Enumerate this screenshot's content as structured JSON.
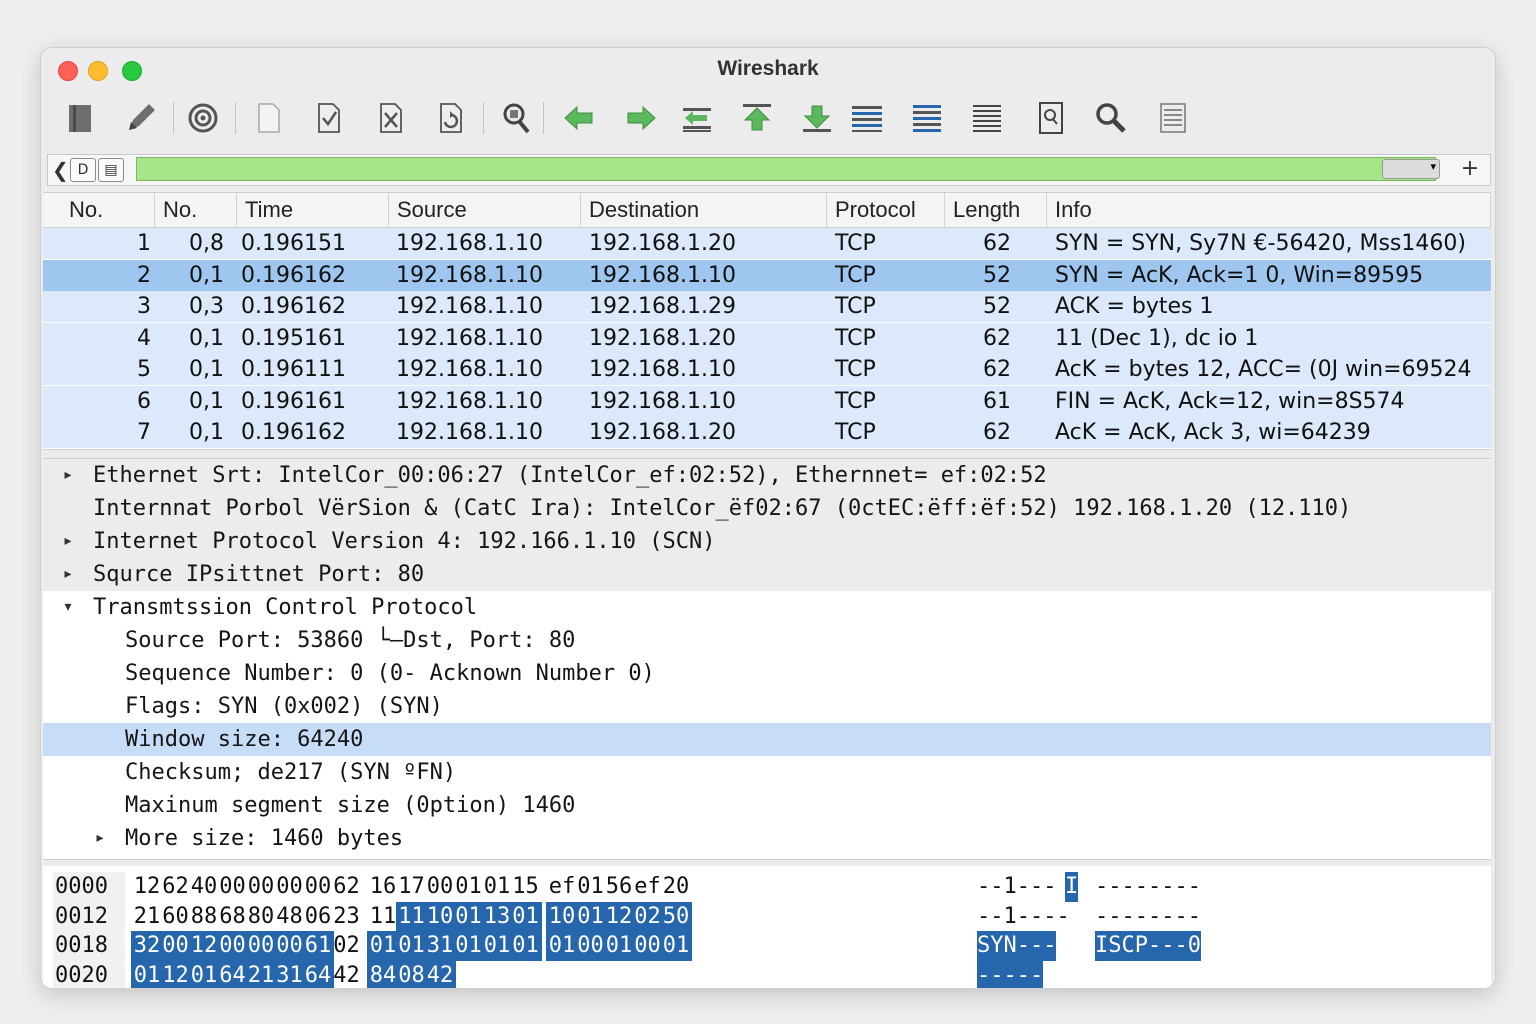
{
  "window": {
    "title": "Wireshark"
  },
  "colors": {
    "filter_bg": "#a8e58a",
    "row_bg": "#dbe9fb",
    "row_selected": "#9ec6ee",
    "hex_highlight": "#2566ad",
    "arrow_green": "#5cb85c"
  },
  "toolbar": {
    "icons": [
      "open-file-icon",
      "edit-icon",
      "capture-target-icon",
      "blank-file-icon",
      "save-icon",
      "close-file-icon",
      "reload-icon",
      "find-packet-icon",
      "go-back-icon",
      "go-forward-icon",
      "go-to-packet-icon",
      "first-packet-icon",
      "last-packet-icon",
      "autoscroll-icon",
      "colorize-icon",
      "resize-columns-icon",
      "zoom-in-icon",
      "zoom-search-icon",
      "column-prefs-icon"
    ]
  },
  "filter": {
    "value": "",
    "placeholder": "",
    "dropdown": "▾",
    "plus": "+",
    "left_arrow": "❮",
    "bookmark": "D",
    "bar_icon": "▤"
  },
  "packet_list": {
    "columns": [
      "No.",
      "No.",
      "Time",
      "Source",
      "Destination",
      "Protocol",
      "Length",
      "Info"
    ],
    "rows": [
      {
        "no": "1",
        "no2": "0,8",
        "time": "0.196151",
        "src": "192.168.1.10",
        "dst": "192.168.1.20",
        "proto": "TCP",
        "len": "62",
        "info": "SYN = SYN, Sy7N €-56420, Mss1460)"
      },
      {
        "no": "2",
        "no2": "0,1",
        "time": "0.196162",
        "src": "192.168.1.10",
        "dst": "192.168.1.10",
        "proto": "TCP",
        "len": "52",
        "info": "SYN = AcK, Ack=1 0, Win=89595"
      },
      {
        "no": "3",
        "no2": "0,3",
        "time": "0.196162",
        "src": "192.168.1.10",
        "dst": "192.168.1.29",
        "proto": "TCP",
        "len": "52",
        "info": "ACK = bytes 1"
      },
      {
        "no": "4",
        "no2": "0,1",
        "time": "0.195161",
        "src": "192.168.1.10",
        "dst": "192.168.1.20",
        "proto": "TCP",
        "len": "62",
        "info": "11 (Dec 1), dc io 1"
      },
      {
        "no": "5",
        "no2": "0,1",
        "time": "0.196111",
        "src": "192.168.1.10",
        "dst": "192.168.1.10",
        "proto": "TCP",
        "len": "62",
        "info": "AcK = bytes 12, ACC= (0J win=69524"
      },
      {
        "no": "6",
        "no2": "0,1",
        "time": "0.196161",
        "src": "192.168.1.10",
        "dst": "192.168.1.10",
        "proto": "TCP",
        "len": "61",
        "info": "FIN = AcK, Ack=12, win=8S574"
      },
      {
        "no": "7",
        "no2": "0,1",
        "time": "0.196162",
        "src": "192.168.1.10",
        "dst": "192.168.1.20",
        "proto": "TCP",
        "len": "62",
        "info": "AcK = AcK, Ack 3, wi=64239"
      }
    ]
  },
  "details": {
    "rows": [
      {
        "text": "Ethernet Srt: IntelCor_00:06:27 (IntelCor_ef:02:52), Ethernnet= ef:02:52",
        "arrow": "▸",
        "indent": 0,
        "style": "gray"
      },
      {
        "text": "Internnat Porbol VërSion & (CatC Ira): IntelCor_ëf02:67 (0ctEC:ëff:ëf:52) 192.168.1.20 (12.110)",
        "arrow": "",
        "indent": 0,
        "style": "gray"
      },
      {
        "text": "Internet Protocol Version 4: 192.166.1.10 (SCN)",
        "arrow": "▸",
        "indent": 0,
        "style": "gray"
      },
      {
        "text": "Squrce IPsittnet Port: 80",
        "arrow": "▸",
        "indent": 0,
        "style": "gray"
      },
      {
        "text": "Transmtssion Control Protocol",
        "arrow": "▾",
        "indent": 0,
        "style": ""
      },
      {
        "text": "Source Port: 53860 └—Dst, Port: 80",
        "arrow": "",
        "indent": 1,
        "style": ""
      },
      {
        "text": "Sequence Number: 0 (0- Acknown Number 0)",
        "arrow": "",
        "indent": 1,
        "style": ""
      },
      {
        "text": "Flags: SYN (0x002) (SYN)",
        "arrow": "",
        "indent": 1,
        "style": ""
      },
      {
        "text": "Window size: 64240",
        "arrow": "",
        "indent": 1,
        "style": "sel"
      },
      {
        "text": "Checksum; de217 (SYN ºFN)",
        "arrow": "",
        "indent": 1,
        "style": ""
      },
      {
        "text": "Maxinum segment size (0ption) 1460",
        "arrow": "",
        "indent": 1,
        "style": ""
      },
      {
        "text": "More size: 1460 bytes",
        "arrow": "▸",
        "indent": 1,
        "style": ""
      }
    ]
  },
  "hex": {
    "rows": [
      {
        "offset": "0000",
        "bytes": [
          "12",
          "62",
          "40",
          "00",
          "00",
          "00",
          "00",
          "62",
          "16",
          "17",
          "00",
          "01",
          "01",
          "15",
          "ef",
          "01",
          "56",
          "ef",
          "20"
        ],
        "hl_from": 99,
        "ascii": [
          "--1---",
          "I",
          "--------"
        ],
        "ascii_hl": [
          false,
          true,
          false
        ]
      },
      {
        "offset": "0012",
        "bytes": [
          "21",
          "60",
          "88",
          "68",
          "80",
          "48",
          "06",
          "23",
          "11",
          "11",
          "10",
          "01",
          "13",
          "01",
          "10",
          "01",
          "12",
          "02",
          "50"
        ],
        "hl_from": 9,
        "ascii": [
          "--1----",
          "",
          "--------"
        ],
        "ascii_hl": [
          false,
          false,
          false
        ]
      },
      {
        "offset": "0018",
        "bytes": [
          "32",
          "00",
          "12",
          "00",
          "00",
          "00",
          "61",
          "02",
          "01",
          "01",
          "31",
          "01",
          "01",
          "01",
          "01",
          "00",
          "01",
          "00",
          "01"
        ],
        "hl_from": 0,
        "hl_skip": 7,
        "ascii": [
          "SYN---",
          "",
          "ISCP---0"
        ],
        "ascii_hl": [
          true,
          false,
          true
        ]
      },
      {
        "offset": "0020",
        "bytes": [
          "01",
          "12",
          "01",
          "64",
          "21",
          "31",
          "64",
          "42",
          "84",
          "08",
          "42"
        ],
        "hl_from": 0,
        "hl_skip": 7,
        "ascii": [
          "-----",
          "",
          ""
        ],
        "ascii_hl": [
          true,
          false,
          false
        ]
      }
    ]
  }
}
